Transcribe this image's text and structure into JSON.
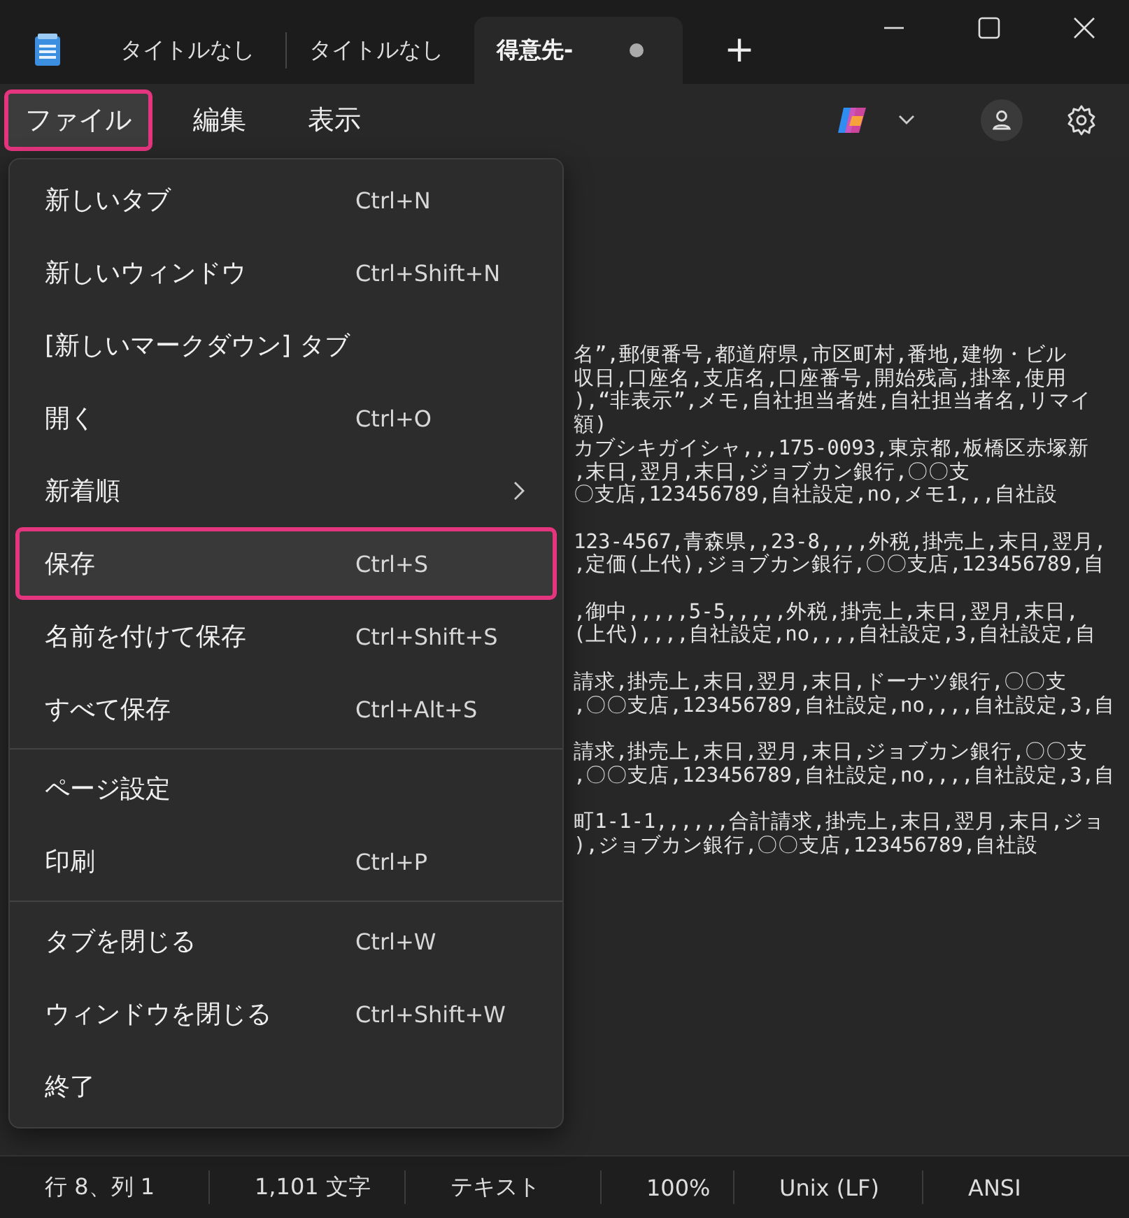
{
  "tabs": [
    {
      "title": "タイトルなし",
      "selected": false,
      "modified": false
    },
    {
      "title": "タイトルなし",
      "selected": false,
      "modified": false
    },
    {
      "title": "得意先-",
      "selected": true,
      "modified": true
    }
  ],
  "new_tab_button": "+",
  "menubar": [
    {
      "label": "ファイル",
      "selected": true,
      "highlighted": true
    },
    {
      "label": "編集",
      "selected": false,
      "highlighted": false
    },
    {
      "label": "表示",
      "selected": false,
      "highlighted": false
    }
  ],
  "menu": {
    "items": [
      {
        "kind": "item",
        "label": "新しいタブ",
        "shortcut": "Ctrl+N",
        "submenu": false,
        "highlighted": false
      },
      {
        "kind": "item",
        "label": "新しいウィンドウ",
        "shortcut": "Ctrl+Shift+N",
        "submenu": false,
        "highlighted": false
      },
      {
        "kind": "item",
        "label": "[新しいマークダウン] タブ",
        "submenu": false,
        "highlighted": false
      },
      {
        "kind": "item",
        "label": "開く",
        "shortcut": "Ctrl+O",
        "submenu": false,
        "highlighted": false
      },
      {
        "kind": "item",
        "label": "新着順",
        "submenu": true,
        "highlighted": false
      },
      {
        "kind": "item",
        "label": "保存",
        "shortcut": "Ctrl+S",
        "submenu": false,
        "highlighted": true
      },
      {
        "kind": "item",
        "label": "名前を付けて保存",
        "shortcut": "Ctrl+Shift+S",
        "submenu": false,
        "highlighted": false
      },
      {
        "kind": "item",
        "label": "すべて保存",
        "shortcut": "Ctrl+Alt+S",
        "submenu": false,
        "highlighted": false
      },
      {
        "kind": "separator"
      },
      {
        "kind": "item",
        "label": "ページ設定",
        "submenu": false,
        "highlighted": false
      },
      {
        "kind": "item",
        "label": "印刷",
        "shortcut": "Ctrl+P",
        "submenu": false,
        "highlighted": false
      },
      {
        "kind": "separator"
      },
      {
        "kind": "item",
        "label": "タブを閉じる",
        "shortcut": "Ctrl+W",
        "submenu": false,
        "highlighted": false
      },
      {
        "kind": "item",
        "label": "ウィンドウを閉じる",
        "shortcut": "Ctrl+Shift+W",
        "submenu": false,
        "highlighted": false
      },
      {
        "kind": "item",
        "label": "終了",
        "submenu": false,
        "highlighted": false
      }
    ]
  },
  "editor": {
    "records": [
      [
        "名”,郵便番号,都道府県,市区町村,番地,建物・ビル",
        "収日,口座名,支店名,口座番号,開始残高,掛率,使用",
        "),“非表示”,メモ,自社担当者姓,自社担当者名,リマイ",
        "額)",
        "カブシキガイシャ,,,175-0093,東京都,板橋区赤塚新",
        ",末日,翌月,末日,ジョブカン銀行,〇〇支",
        "〇支店,123456789,自社設定,no,メモ1,,,自社設"
      ],
      [
        "123-4567,青森県,,23-8,,,,外税,掛売上,末日,翌月,",
        ",定価(上代),ジョブカン銀行,〇〇支店,123456789,自"
      ],
      [
        ",御中,,,,,5-5,,,,,外税,掛売上,末日,翌月,末日,",
        "(上代),,,,自社設定,no,,,,自社設定,3,自社設定,自"
      ],
      [
        "請求,掛売上,末日,翌月,末日,ドーナツ銀行,〇〇支",
        ",〇〇支店,123456789,自社設定,no,,,,自社設定,3,自"
      ],
      [
        "請求,掛売上,末日,翌月,末日,ジョブカン銀行,〇〇支",
        ",〇〇支店,123456789,自社設定,no,,,,自社設定,3,自"
      ],
      [
        "町1-1-1,,,,,,合計請求,掛売上,末日,翌月,末日,ジョ",
        "),ジョブカン銀行,〇〇支店,123456789,自社設"
      ]
    ]
  },
  "status_bar": [
    "行 8、列 1",
    "1,101 文字",
    "テキスト",
    "100%",
    "Unix (LF)",
    "ANSI"
  ]
}
